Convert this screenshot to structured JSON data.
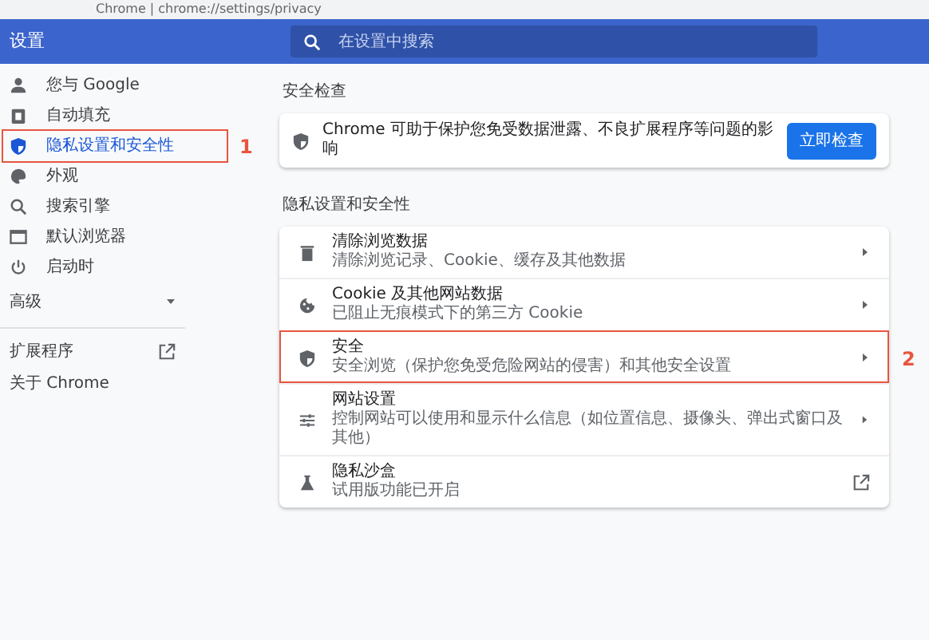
{
  "address_bar": {
    "text": "Chrome | chrome://settings/privacy"
  },
  "header": {
    "title": "设置",
    "search": {
      "placeholder": "在设置中搜索"
    }
  },
  "sidebar": {
    "items": [
      {
        "kind": "nav",
        "label": "您与 Google",
        "selected": false,
        "highlighted": false
      },
      {
        "kind": "nav",
        "label": "自动填充",
        "selected": false,
        "highlighted": false
      },
      {
        "kind": "nav",
        "label": "隐私设置和安全性",
        "selected": true,
        "highlighted": true,
        "annotation": "1"
      },
      {
        "kind": "nav",
        "label": "外观",
        "selected": false,
        "highlighted": false
      },
      {
        "kind": "nav",
        "label": "搜索引擎",
        "selected": false,
        "highlighted": false
      },
      {
        "kind": "nav",
        "label": "默认浏览器",
        "selected": false,
        "highlighted": false
      },
      {
        "kind": "nav",
        "label": "启动时",
        "selected": false,
        "highlighted": false
      },
      {
        "kind": "section",
        "label": "高级",
        "expanded": false
      },
      {
        "kind": "link",
        "label": "扩展程序",
        "external": true
      },
      {
        "kind": "link",
        "label": "关于 Chrome",
        "external": false
      }
    ]
  },
  "safety_check": {
    "title": "安全检查",
    "text": "Chrome 可助于保护您免受数据泄露、不良扩展程序等问题的影响",
    "button": "立即检查"
  },
  "privacy": {
    "title": "隐私设置和安全性",
    "rows": [
      {
        "kind": "arrow",
        "title": "清除浏览数据",
        "subtitle": "清除浏览记录、Cookie、缓存及其他数据",
        "highlighted": false
      },
      {
        "kind": "arrow",
        "title": "Cookie 及其他网站数据",
        "subtitle": "已阻止无痕模式下的第三方 Cookie",
        "highlighted": false
      },
      {
        "kind": "arrow",
        "title": "安全",
        "subtitle": "安全浏览（保护您免受危险网站的侵害）和其他安全设置",
        "highlighted": true,
        "annotation": "2"
      },
      {
        "kind": "arrow",
        "title": "网站设置",
        "subtitle": "控制网站可以使用和显示什么信息（如位置信息、摄像头、弹出式窗口及其他）",
        "highlighted": false
      },
      {
        "kind": "external",
        "title": "隐私沙盒",
        "subtitle": "试用版功能已开启",
        "highlighted": false
      }
    ]
  }
}
